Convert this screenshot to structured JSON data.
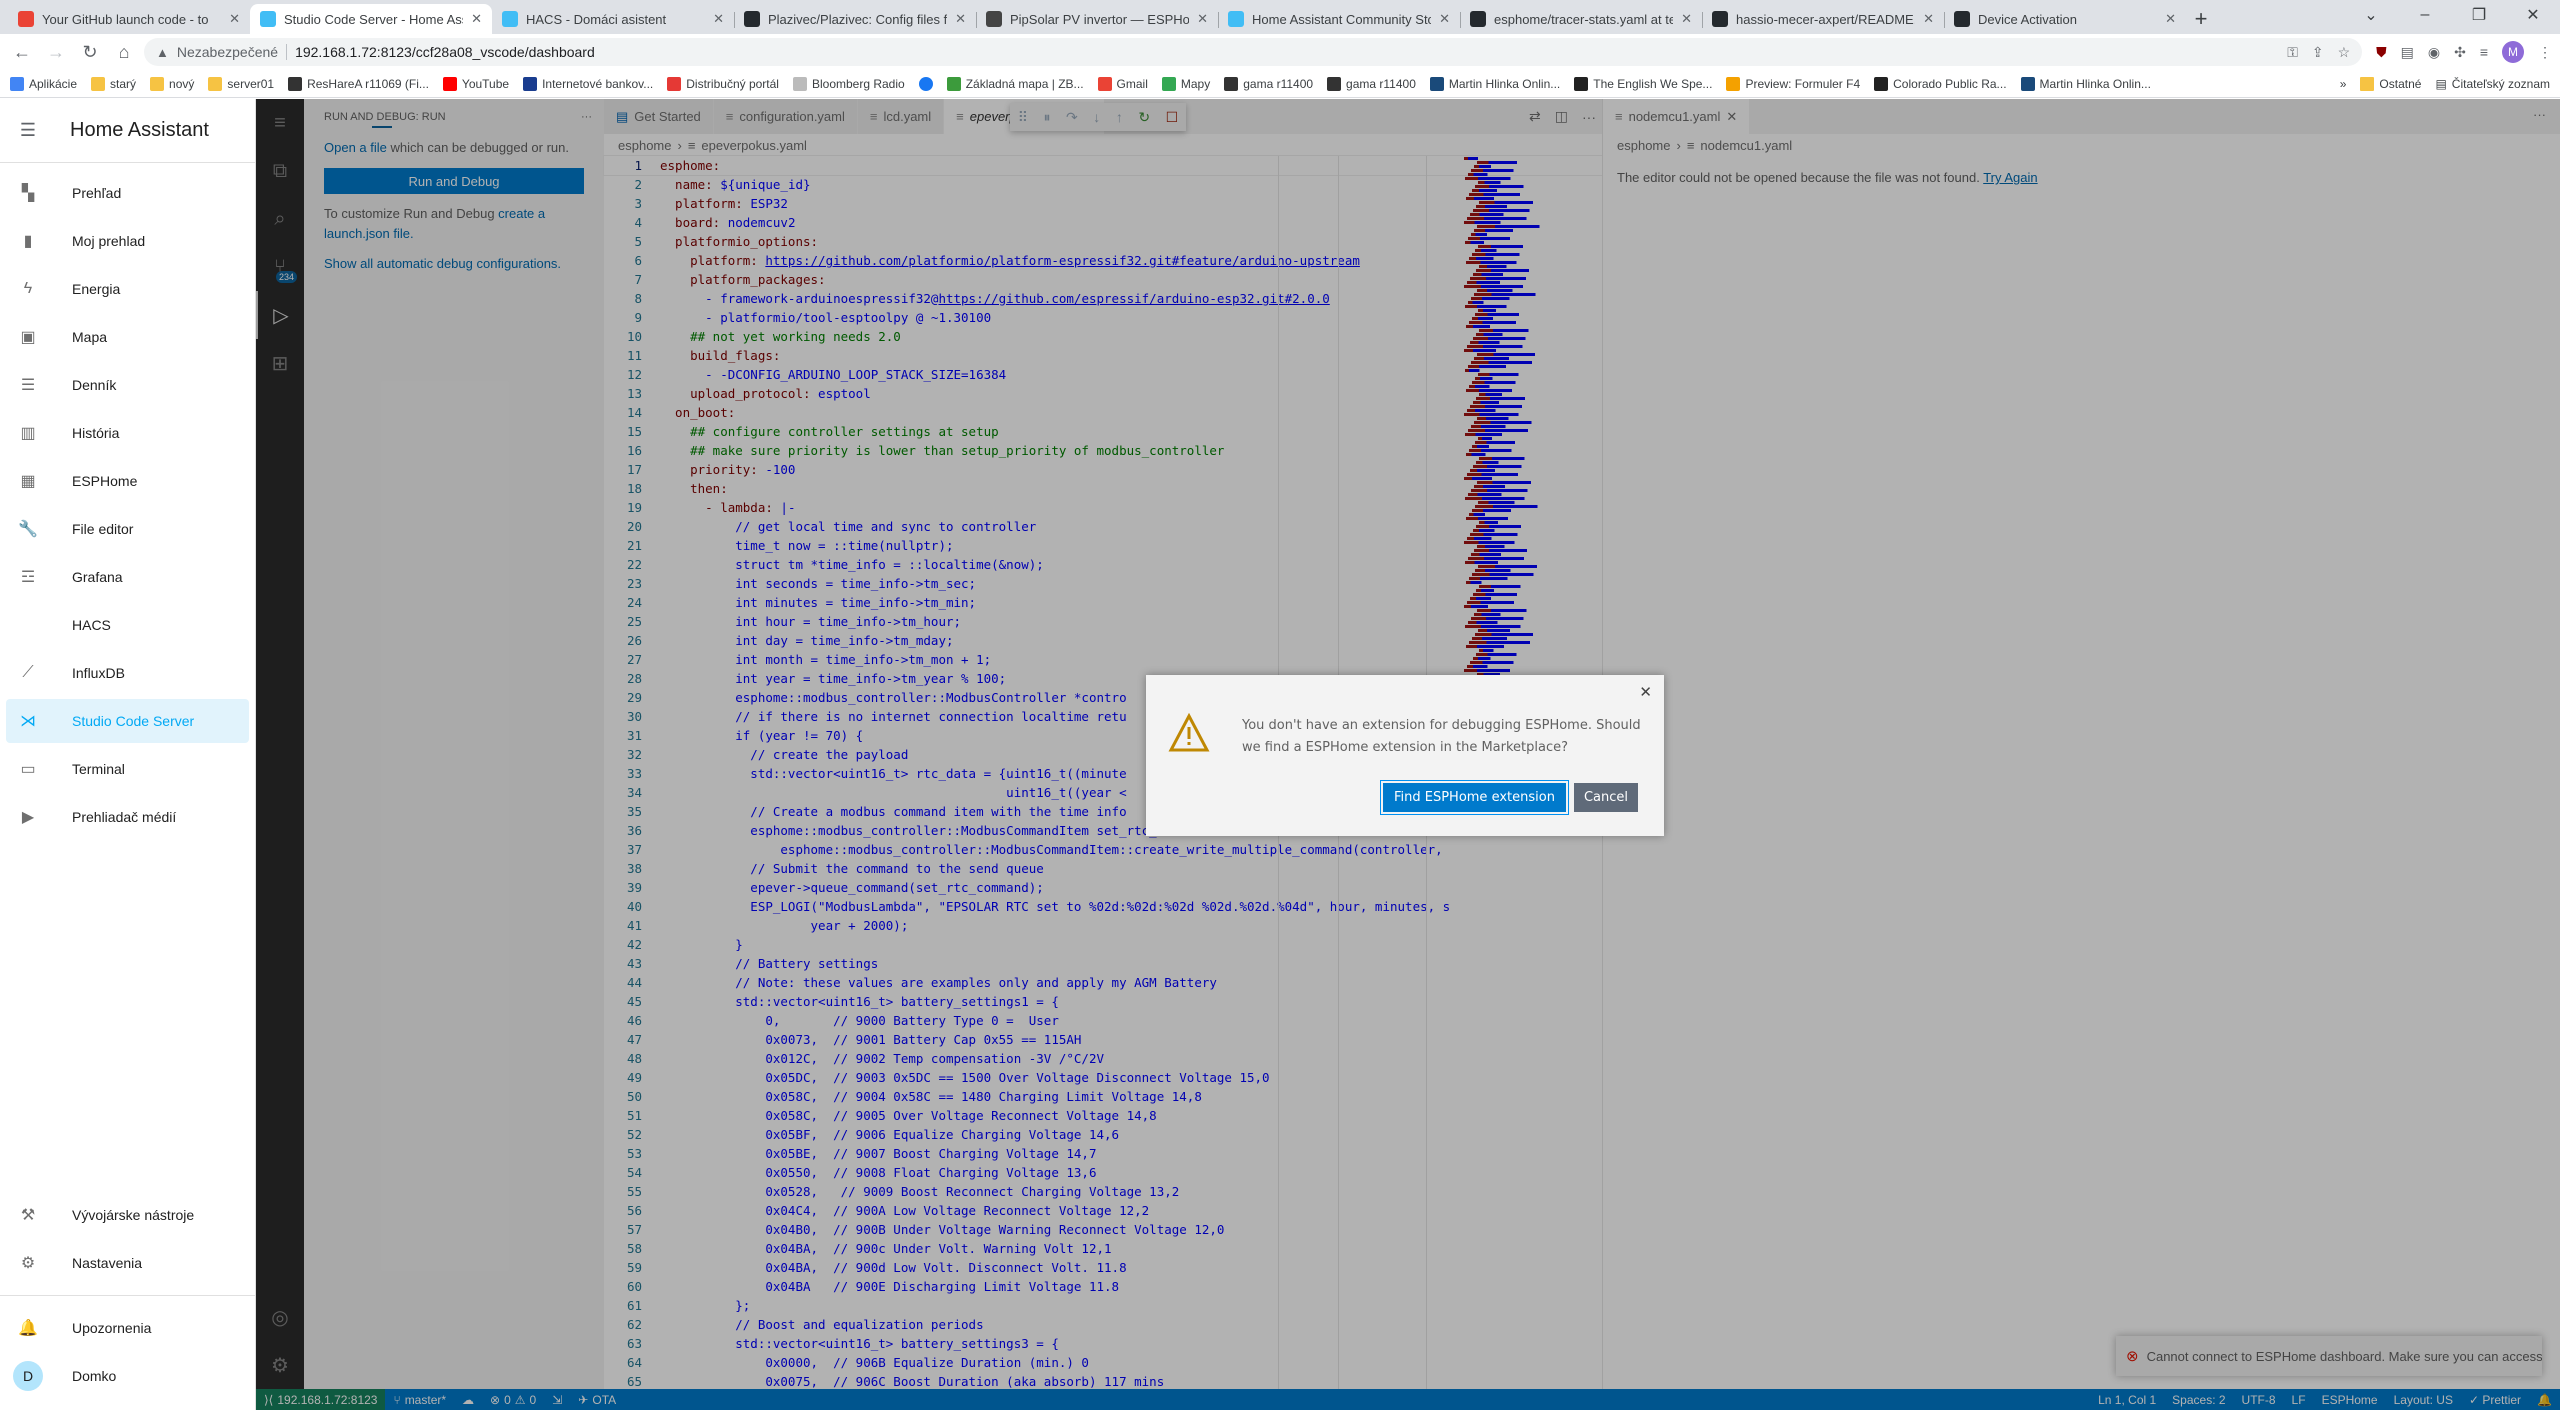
{
  "browser": {
    "tabs": [
      {
        "title": "Your GitHub launch code - to",
        "icon": "gmail-icon",
        "color": "#ea4335",
        "active": false
      },
      {
        "title": "Studio Code Server - Home Assis",
        "icon": "home-assistant-icon",
        "color": "#41bdf5",
        "active": true
      },
      {
        "title": "HACS - Domáci asistent",
        "icon": "home-assistant-icon",
        "color": "#41bdf5",
        "active": false
      },
      {
        "title": "Plazivec/Plazivec: Config files for",
        "icon": "github-icon",
        "color": "#24292e",
        "active": false
      },
      {
        "title": "PipSolar PV invertor — ESPHome",
        "icon": "esphome-icon",
        "color": "#444",
        "active": false
      },
      {
        "title": "Home Assistant Community Store",
        "icon": "hacs-icon",
        "color": "#41bdf5",
        "active": false
      },
      {
        "title": "esphome/tracer-stats.yaml at tes",
        "icon": "github-icon",
        "color": "#24292e",
        "active": false
      },
      {
        "title": "hassio-mecer-axpert/README.m",
        "icon": "github-icon",
        "color": "#24292e",
        "active": false
      },
      {
        "title": "Device Activation",
        "icon": "github-icon",
        "color": "#24292e",
        "active": false
      }
    ],
    "new_tab": "+",
    "address": {
      "security_label": "Nezabezpečené",
      "url": "192.168.1.72:8123/ccf28a08_vscode/dashboard"
    },
    "profile_initial": "M",
    "bookmarks": [
      {
        "label": "Aplikácie",
        "icon": "apps-icon"
      },
      {
        "label": "starý",
        "icon": "folder-icon"
      },
      {
        "label": "nový",
        "icon": "folder-icon"
      },
      {
        "label": "server01",
        "icon": "folder-icon"
      },
      {
        "label": "ResHareA r11069 (Fi...",
        "icon": "oscam-icon"
      },
      {
        "label": "YouTube",
        "icon": "youtube-icon"
      },
      {
        "label": "Internetové bankov...",
        "icon": "bank-icon"
      },
      {
        "label": "Distribučný portál",
        "icon": "lightning-icon"
      },
      {
        "label": "Bloomberg Radio",
        "icon": "radio-icon"
      },
      {
        "label": "",
        "icon": "facebook-icon"
      },
      {
        "label": "Základná mapa | ZB...",
        "icon": "map-icon"
      },
      {
        "label": "Gmail",
        "icon": "gmail-icon"
      },
      {
        "label": "Mapy",
        "icon": "maps-pin-icon"
      },
      {
        "label": "gama r11400",
        "icon": "oscam-icon"
      },
      {
        "label": "gama r11400",
        "icon": "oscam-icon"
      },
      {
        "label": "Martin Hlinka Onlin...",
        "icon": "chat-icon"
      },
      {
        "label": "The English We Spe...",
        "icon": "page-icon"
      },
      {
        "label": "Preview: Formuler F4",
        "icon": "preview-icon"
      },
      {
        "label": "Colorado Public Ra...",
        "icon": "page-icon"
      },
      {
        "label": "Martin Hlinka Onlin...",
        "icon": "chat-icon"
      }
    ],
    "bookmarks_more": "»",
    "other_bookmarks": "Ostatné",
    "reading_list": "Čitateľský zoznam"
  },
  "ha_sidebar": {
    "title": "Home Assistant",
    "items": [
      {
        "label": "Prehľad",
        "icon": "dashboard-icon",
        "glyph": "▚"
      },
      {
        "label": "Moj prehlad",
        "icon": "battery-charging-icon",
        "glyph": "▮"
      },
      {
        "label": "Energia",
        "icon": "lightning-bolt-icon",
        "glyph": "ϟ"
      },
      {
        "label": "Mapa",
        "icon": "map-account-icon",
        "glyph": "▣"
      },
      {
        "label": "Denník",
        "icon": "list-icon",
        "glyph": "☰"
      },
      {
        "label": "História",
        "icon": "chart-bar-icon",
        "glyph": "▥"
      },
      {
        "label": "ESPHome",
        "icon": "chip-icon",
        "glyph": "▦"
      },
      {
        "label": "File editor",
        "icon": "wrench-icon",
        "glyph": "🔧"
      },
      {
        "label": "Grafana",
        "icon": "chart-timeline-icon",
        "glyph": "☲"
      },
      {
        "label": "HACS",
        "icon": "hacs-icon",
        "glyph": ""
      },
      {
        "label": "InfluxDB",
        "icon": "chart-areaspline-icon",
        "glyph": "⟋"
      },
      {
        "label": "Studio Code Server",
        "icon": "vscode-icon",
        "glyph": "⋊",
        "active": true
      },
      {
        "label": "Terminal",
        "icon": "console-icon",
        "glyph": "▭"
      },
      {
        "label": "Prehliadač médií",
        "icon": "play-box-multiple-icon",
        "glyph": "▶"
      }
    ],
    "dev_tools": "Vývojárske nástroje",
    "settings": "Nastavenia",
    "notifications": "Upozornenia",
    "user_initial": "D",
    "user_name": "Domko"
  },
  "vscode": {
    "activity_badge": "234",
    "run_panel": {
      "title": "RUN AND DEBUG: RUN",
      "more": "···",
      "open_file_link": "Open a file",
      "open_file_rest": " which can be debugged or run.",
      "run_button": "Run and Debug",
      "customize_text": "To customize Run and Debug ",
      "customize_link": "create a launch.json file.",
      "show_all_link": "Show all automatic debug configurations."
    },
    "editor_tabs": [
      {
        "label": "Get Started",
        "icon": "get-started-icon",
        "active": false
      },
      {
        "label": "configuration.yaml",
        "icon": "file-icon",
        "active": false
      },
      {
        "label": "lcd.yaml",
        "icon": "file-icon",
        "active": false
      },
      {
        "label": "epeverpokus.yaml",
        "icon": "file-icon",
        "active": true
      }
    ],
    "breadcrumb": {
      "folder": "esphome",
      "file": "epeverpokus.yaml"
    },
    "code_lines": [
      [
        [
          "k",
          "esphome:"
        ]
      ],
      [
        [
          "k",
          "  name: "
        ],
        [
          "s",
          "${unique_id}"
        ]
      ],
      [
        [
          "k",
          "  platform: "
        ],
        [
          "s",
          "ESP32"
        ]
      ],
      [
        [
          "k",
          "  board: "
        ],
        [
          "s",
          "nodemcuv2"
        ]
      ],
      [
        [
          "k",
          "  platformio_options:"
        ]
      ],
      [
        [
          "k",
          "    platform: "
        ],
        [
          "u",
          "https://github.com/platformio/platform-espressif32.git#feature/arduino-upstream"
        ]
      ],
      [
        [
          "k",
          "    platform_packages:"
        ]
      ],
      [
        [
          "s",
          "      - framework-arduinoespressif32@"
        ],
        [
          "u",
          "https://github.com/espressif/arduino-esp32.git#2.0.0"
        ]
      ],
      [
        [
          "s",
          "      - platformio/tool-esptoolpy @ ~1.30100"
        ]
      ],
      [
        [
          "c",
          "    ## not yet working needs 2.0"
        ]
      ],
      [
        [
          "k",
          "    build_flags:"
        ]
      ],
      [
        [
          "s",
          "      - -DCONFIG_ARDUINO_LOOP_STACK_SIZE=16384"
        ]
      ],
      [
        [
          "k",
          "    upload_protocol: "
        ],
        [
          "s",
          "esptool"
        ]
      ],
      [
        [
          "k",
          "  on_boot:"
        ]
      ],
      [
        [
          "c",
          "    ## configure controller settings at setup"
        ]
      ],
      [
        [
          "c",
          "    ## make sure priority is lower than setup_priority of modbus_controller"
        ]
      ],
      [
        [
          "k",
          "    priority: "
        ],
        [
          "s",
          "-100"
        ]
      ],
      [
        [
          "k",
          "    then:"
        ]
      ],
      [
        [
          "k",
          "      - lambda: "
        ],
        [
          "s",
          "|-"
        ]
      ],
      [
        [
          "s",
          "          // get local time and sync to controller"
        ]
      ],
      [
        [
          "s",
          "          time_t now = ::time(nullptr);"
        ]
      ],
      [
        [
          "s",
          "          struct tm *time_info = ::localtime(&now);"
        ]
      ],
      [
        [
          "s",
          "          int seconds = time_info->tm_sec;"
        ]
      ],
      [
        [
          "s",
          "          int minutes = time_info->tm_min;"
        ]
      ],
      [
        [
          "s",
          "          int hour = time_info->tm_hour;"
        ]
      ],
      [
        [
          "s",
          "          int day = time_info->tm_mday;"
        ]
      ],
      [
        [
          "s",
          "          int month = time_info->tm_mon + 1;"
        ]
      ],
      [
        [
          "s",
          "          int year = time_info->tm_year % 100;"
        ]
      ],
      [
        [
          "s",
          "          esphome::modbus_controller::ModbusController *contro"
        ]
      ],
      [
        [
          "s",
          "          // if there is no internet connection localtime retu"
        ]
      ],
      [
        [
          "s",
          "          if (year != 70) {"
        ]
      ],
      [
        [
          "s",
          "            // create the payload"
        ]
      ],
      [
        [
          "s",
          "            std::vector<uint16_t> rtc_data = {uint16_t((minute"
        ]
      ],
      [
        [
          "s",
          "                                              uint16_t((year <"
        ]
      ],
      [
        [
          "s",
          "            // Create a modbus command item with the time info"
        ]
      ],
      [
        [
          "s",
          "            esphome::modbus_controller::ModbusCommandItem set_rtc_command"
        ]
      ],
      [
        [
          "s",
          "                esphome::modbus_controller::ModbusCommandItem::create_write_multiple_command(controller, "
        ]
      ],
      [
        [
          "s",
          "            // Submit the command to the send queue"
        ]
      ],
      [
        [
          "s",
          "            epever->queue_command(set_rtc_command);"
        ]
      ],
      [
        [
          "s",
          "            ESP_LOGI(\"ModbusLambda\", \"EPSOLAR RTC set to %02d:%02d:%02d %02d.%02d.%04d\", hour, minutes, s"
        ]
      ],
      [
        [
          "s",
          "                    year + 2000);"
        ]
      ],
      [
        [
          "s",
          "          }"
        ]
      ],
      [
        [
          "s",
          "          // Battery settings"
        ]
      ],
      [
        [
          "s",
          "          // Note: these values are examples only and apply my AGM Battery"
        ]
      ],
      [
        [
          "s",
          "          std::vector<uint16_t> battery_settings1 = {"
        ]
      ],
      [
        [
          "s",
          "              0,       // 9000 Battery Type 0 =  User"
        ]
      ],
      [
        [
          "s",
          "              0x0073,  // 9001 Battery Cap 0x55 == 115AH"
        ]
      ],
      [
        [
          "s",
          "              0x012C,  // 9002 Temp compensation -3V /°C/2V"
        ]
      ],
      [
        [
          "s",
          "              0x05DC,  // 9003 0x5DC == 1500 Over Voltage Disconnect Voltage 15,0"
        ]
      ],
      [
        [
          "s",
          "              0x058C,  // 9004 0x58C == 1480 Charging Limit Voltage 14,8"
        ]
      ],
      [
        [
          "s",
          "              0x058C,  // 9005 Over Voltage Reconnect Voltage 14,8"
        ]
      ],
      [
        [
          "s",
          "              0x05BF,  // 9006 Equalize Charging Voltage 14,6"
        ]
      ],
      [
        [
          "s",
          "              0x05BE,  // 9007 Boost Charging Voltage 14,7"
        ]
      ],
      [
        [
          "s",
          "              0x0550,  // 9008 Float Charging Voltage 13,6"
        ]
      ],
      [
        [
          "s",
          "              0x0528,   // 9009 Boost Reconnect Charging Voltage 13,2"
        ]
      ],
      [
        [
          "s",
          "              0x04C4,  // 900A Low Voltage Reconnect Voltage 12,2"
        ]
      ],
      [
        [
          "s",
          "              0x04B0,  // 900B Under Voltage Warning Reconnect Voltage 12,0"
        ]
      ],
      [
        [
          "s",
          "              0x04BA,  // 900c Under Volt. Warning Volt 12,1"
        ]
      ],
      [
        [
          "s",
          "              0x04BA,  // 900d Low Volt. Disconnect Volt. 11.8"
        ]
      ],
      [
        [
          "s",
          "              0x04BA   // 900E Discharging Limit Voltage 11.8"
        ]
      ],
      [
        [
          "s",
          "          };"
        ]
      ],
      [
        [
          "s",
          "          // Boost and equalization periods"
        ]
      ],
      [
        [
          "s",
          "          std::vector<uint16_t> battery_settings3 = {"
        ]
      ],
      [
        [
          "s",
          "              0x0000,  // 906B Equalize Duration (min.) 0"
        ]
      ],
      [
        [
          "s",
          "              0x0075,  // 906C Boost Duration (aka absorb) 117 mins"
        ]
      ]
    ],
    "second_editor": {
      "tab": "nodemcu1.yaml",
      "breadcrumb": {
        "folder": "esphome",
        "file": "nodemcu1.yaml"
      },
      "message": "The editor could not be opened because the file was not found. ",
      "try_again": "Try Again"
    },
    "status_bar": {
      "remote": "192.168.1.72:8123",
      "branch": "master*",
      "errors": "0",
      "warnings": "0",
      "ota": "OTA",
      "position": "Ln 1, Col 1",
      "spaces": "Spaces: 2",
      "encoding": "UTF-8",
      "eol": "LF",
      "language": "ESPHome",
      "layout": "Layout: US",
      "prettier": "✓ Prettier"
    },
    "toast": "Cannot connect to ESPHome dashboard. Make sure you can access 'ht..."
  },
  "dialog": {
    "message": "You don't have an extension for debugging ESPHome. Should we find a ESPHome extension in the Marketplace?",
    "primary_button": "Find ESPHome extension",
    "cancel_button": "Cancel",
    "warning_color": "#bf8803"
  }
}
